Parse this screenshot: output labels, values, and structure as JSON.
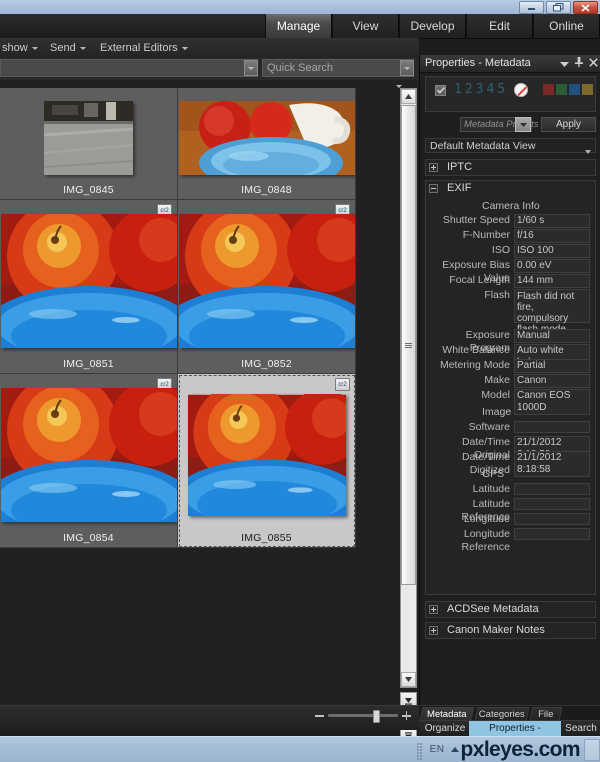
{
  "window": {
    "controls": [
      {
        "name": "minimize",
        "label": "Minimize"
      },
      {
        "name": "restore",
        "label": "Restore"
      },
      {
        "name": "close",
        "label": "Close"
      }
    ]
  },
  "modebar": {
    "tabs": [
      {
        "label": "Manage",
        "active": true
      },
      {
        "label": "View",
        "active": false
      },
      {
        "label": "Develop",
        "active": false
      },
      {
        "label": "Edit",
        "active": false
      },
      {
        "label": "Online",
        "active": false
      }
    ]
  },
  "toolbar": {
    "items": [
      {
        "label": "show",
        "has_caret": true
      },
      {
        "label": "Send",
        "has_caret": true
      },
      {
        "label": "External Editors",
        "has_caret": true
      }
    ],
    "overflow_icon": "chevron-down-icon"
  },
  "search": {
    "path_value": "",
    "quick_search_placeholder": "Quick Search"
  },
  "browser": {
    "thumbnails": [
      {
        "name": "IMG_0845",
        "selected": false,
        "has_badge": false,
        "image": "street-pavement"
      },
      {
        "name": "IMG_0848",
        "selected": false,
        "has_badge": false,
        "image": "apples-bowl-mug"
      },
      {
        "name": "IMG_0851",
        "selected": false,
        "has_badge": true,
        "image": "apple-blue-bowl"
      },
      {
        "name": "IMG_0852",
        "selected": false,
        "has_badge": true,
        "image": "apple-blue-bowl"
      },
      {
        "name": "IMG_0854",
        "selected": false,
        "has_badge": true,
        "image": "apple-blue-bowl"
      },
      {
        "name": "IMG_0855",
        "selected": true,
        "has_badge": true,
        "image": "apple-blue-bowl"
      }
    ],
    "badge_text": "cr2",
    "zoom_slider_value": 68
  },
  "panel": {
    "title": "Properties - Metadata",
    "header_buttons": [
      "chevron-down-icon",
      "pin-icon",
      "close-icon"
    ],
    "rating": {
      "checkbox_checked": true,
      "digits": [
        "1",
        "2",
        "3",
        "4",
        "5"
      ],
      "no_rating_icon": "no-rating-icon",
      "color_labels": [
        "#7a2a26",
        "#2a5c38",
        "#21507e",
        "#7d6a2c"
      ]
    },
    "presets": {
      "placeholder": "Metadata Presets (",
      "apply_label": "Apply"
    },
    "view_selector": {
      "value": "Default Metadata View"
    },
    "sections": [
      {
        "name": "IPTC",
        "expanded": false
      },
      {
        "name": "EXIF",
        "expanded": true
      },
      {
        "name": "ACDSee Metadata",
        "expanded": false
      },
      {
        "name": "Canon Maker Notes",
        "expanded": false
      }
    ],
    "exif": {
      "groups": [
        {
          "name": "Camera Info",
          "fields": [
            {
              "label": "Shutter Speed",
              "value": "1/60 s"
            },
            {
              "label": "F-Number",
              "value": "f/16"
            },
            {
              "label": "ISO",
              "value": "ISO 100"
            },
            {
              "label": "Exposure Bias Value",
              "value": "0.00 eV"
            },
            {
              "label": "Focal Length",
              "value": "144 mm"
            },
            {
              "label": "Flash",
              "value": "Flash did not fire, compulsory flash mode"
            },
            {
              "label": "Exposure Program",
              "value": "Manual"
            },
            {
              "label": "White Balance",
              "value": "Auto white balance"
            },
            {
              "label": "Metering Mode",
              "value": "Partial"
            },
            {
              "label": "Make",
              "value": "Canon"
            },
            {
              "label": "Model",
              "value": "Canon EOS 1000D"
            }
          ]
        },
        {
          "name": "Image",
          "fields": [
            {
              "label": "Software",
              "value": ""
            },
            {
              "label": "Date/Time Original",
              "value": "21/1/2012 8:18:58"
            },
            {
              "label": "Date/Time Digitized",
              "value": "21/1/2012 8:18:58"
            }
          ]
        },
        {
          "name": "GPS",
          "fields": [
            {
              "label": "Latitude",
              "value": ""
            },
            {
              "label": "Latitude Reference",
              "value": ""
            },
            {
              "label": "Longitude",
              "value": ""
            },
            {
              "label": "Longitude Reference",
              "value": ""
            }
          ]
        }
      ]
    },
    "bottom_tabs": [
      {
        "label": "Metadata",
        "active": true
      },
      {
        "label": "Categories",
        "active": false
      },
      {
        "label": "File",
        "active": false
      }
    ],
    "bottom_buttons": [
      {
        "label": "Organize",
        "selected": false
      },
      {
        "label": "Properties - Metadata",
        "selected": true
      },
      {
        "label": "Search",
        "selected": false
      }
    ]
  },
  "taskbar": {
    "language": "EN",
    "brand": "pxleyes.com"
  }
}
